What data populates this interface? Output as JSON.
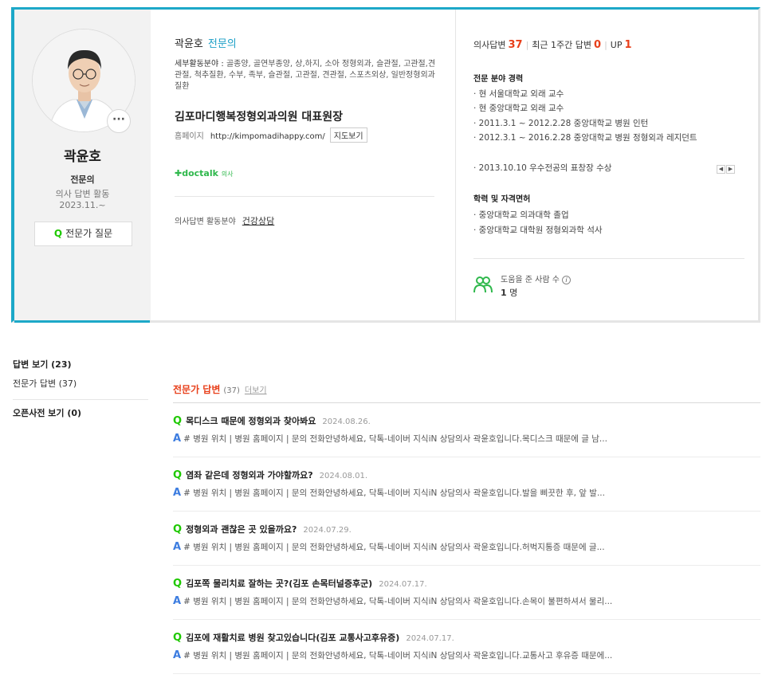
{
  "profile": {
    "name": "곽윤호",
    "specialist": "전문의",
    "more": "···",
    "left_title": "전문의",
    "activity_label": "의사 답변 활동",
    "activity_since": "2023.11.~",
    "ask_button": "전문가 질문",
    "ask_icon": "Q",
    "detail_label": "세부활동분야 :",
    "detail_text": "골종양, 골연부종양, 상,하지, 소아 정형외과, 슬관절, 고관절,견관절, 척추질환, 수부, 족부, 슬관절, 고관절, 견관절, 스포츠외상, 일반정형외과질환",
    "hospital": "김포마디행복정형외과의원 대표원장",
    "homepage_label": "홈페이지",
    "homepage_url": "http://kimpomadihappy.com/",
    "map_button": "지도보기",
    "doctalk": "doctalk",
    "doctalk_suffix": "의사",
    "field_label": "의사답변 활동분야",
    "field_value": "건강상담"
  },
  "stats": {
    "answers_label": "의사답변",
    "answers_value": "37",
    "recent_label": "최근 1주간 답변",
    "recent_value": "0",
    "up_label": "UP",
    "up_value": "1"
  },
  "career": {
    "title": "전문 분야 경력",
    "items": [
      "· 현 서울대학교 외래 교수",
      "· 현 중앙대학교 외래 교수",
      "· 2011.3.1 ~ 2012.2.28 중앙대학교 병원 인턴",
      "· 2012.3.1 ~ 2016.2.28 중앙대학교 병원 정형외과 레지던트",
      "· 2013.10.10 우수전공의 표창장 수상"
    ]
  },
  "education": {
    "title": "학력 및 자격면허",
    "items": [
      "· 중앙대학교 의과대학 졸업",
      "· 중앙대학교 대학원 정형외과학 석사"
    ]
  },
  "helped": {
    "label": "도움을 준 사람 수",
    "count": "1",
    "unit": "명"
  },
  "nav": {
    "answers": "답변 보기 (23)",
    "expert_answers": "전문가 답변 (37)",
    "open_dict": "오픈사전 보기 (0)"
  },
  "list": {
    "title": "전문가 답변",
    "count": "(37)",
    "more": "더보기",
    "items": [
      {
        "q": "목디스크 때문에 정형외과 찾아봐요",
        "date": "2024.08.26.",
        "a": "# 병원 위치 | 병원 홈페이지 | 문의 전화안녕하세요, 닥톡-네이버 지식iN 상담의사 곽윤호입니다.목디스크 때문에 글 남..."
      },
      {
        "q": "염좌 같은데 정형외과 가야할까요?",
        "date": "2024.08.01.",
        "a": "# 병원 위치 | 병원 홈페이지 | 문의 전화안녕하세요, 닥톡-네이버 지식iN 상담의사 곽윤호입니다.발을 삐끗한 후, 앞 발..."
      },
      {
        "q": "정형외과 괜찮은 곳 있을까요?",
        "date": "2024.07.29.",
        "a": "# 병원 위치 | 병원 홈페이지 | 문의 전화안녕하세요, 닥톡-네이버 지식iN 상담의사 곽윤호입니다.허벅지통증 때문에 글..."
      },
      {
        "q": "김포쪽 물리치료 잘하는 곳?(김포 손목터널증후군)",
        "date": "2024.07.17.",
        "a": "# 병원 위치 | 병원 홈페이지 | 문의 전화안녕하세요, 닥톡-네이버 지식iN 상담의사 곽윤호입니다.손목이 불편하셔서 물리..."
      },
      {
        "q": "김포에 재활치료 병원 찾고있습니다(김포 교통사고후유증)",
        "date": "2024.07.17.",
        "a": "# 병원 위치 | 병원 홈페이지 | 문의 전화안녕하세요, 닥톡-네이버 지식iN 상담의사 곽윤호입니다.교통사고 후유증 때문에..."
      }
    ]
  }
}
